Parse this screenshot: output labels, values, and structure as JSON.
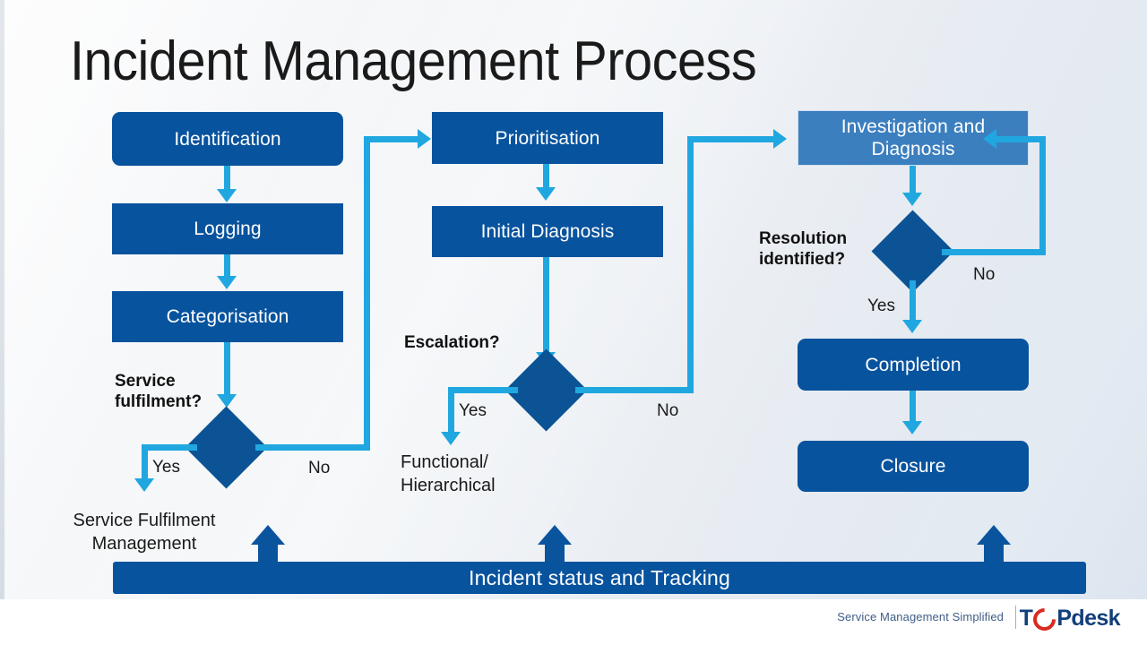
{
  "slide": {
    "title": "Incident Management Process"
  },
  "columns": {
    "left": {
      "boxes": [
        {
          "label": "Identification"
        },
        {
          "label": "Logging"
        },
        {
          "label": "Categorisation"
        }
      ],
      "decision": {
        "question": "Service\nfulfilment?",
        "question_line1": "Service",
        "question_line2": "fulfilment?",
        "yes_label": "Yes",
        "no_label": "No"
      },
      "outcome_line1": "Service Fulfilment",
      "outcome_line2": "Management"
    },
    "middle": {
      "boxes": [
        {
          "label": "Prioritisation"
        },
        {
          "label": "Initial Diagnosis"
        }
      ],
      "decision": {
        "question": "Escalation?",
        "yes_label": "Yes",
        "no_label": "No"
      },
      "outcome_line1": "Functional/",
      "outcome_line2": "Hierarchical"
    },
    "right": {
      "boxes": [
        {
          "label": "Investigation and Diagnosis",
          "line1": "Investigation and",
          "line2": "Diagnosis"
        },
        {
          "label": "Completion"
        },
        {
          "label": "Closure"
        }
      ],
      "decision": {
        "question_line1": "Resolution",
        "question_line2": "identified?",
        "yes_label": "Yes",
        "no_label": "No"
      }
    }
  },
  "tracking_bar": {
    "label": "Incident status and Tracking"
  },
  "footer": {
    "tagline": "Service Management Simplified",
    "brand_prefix": "T",
    "brand_suffix": "Pdesk"
  },
  "colors": {
    "box_blue": "#08539E",
    "box_light_blue": "#3C7FBF",
    "diamond_blue": "#0B5394",
    "arrow_blue": "#20A7E0",
    "bar_blue": "#08539E",
    "logo_navy": "#123F7B",
    "logo_red": "#D82B20"
  }
}
